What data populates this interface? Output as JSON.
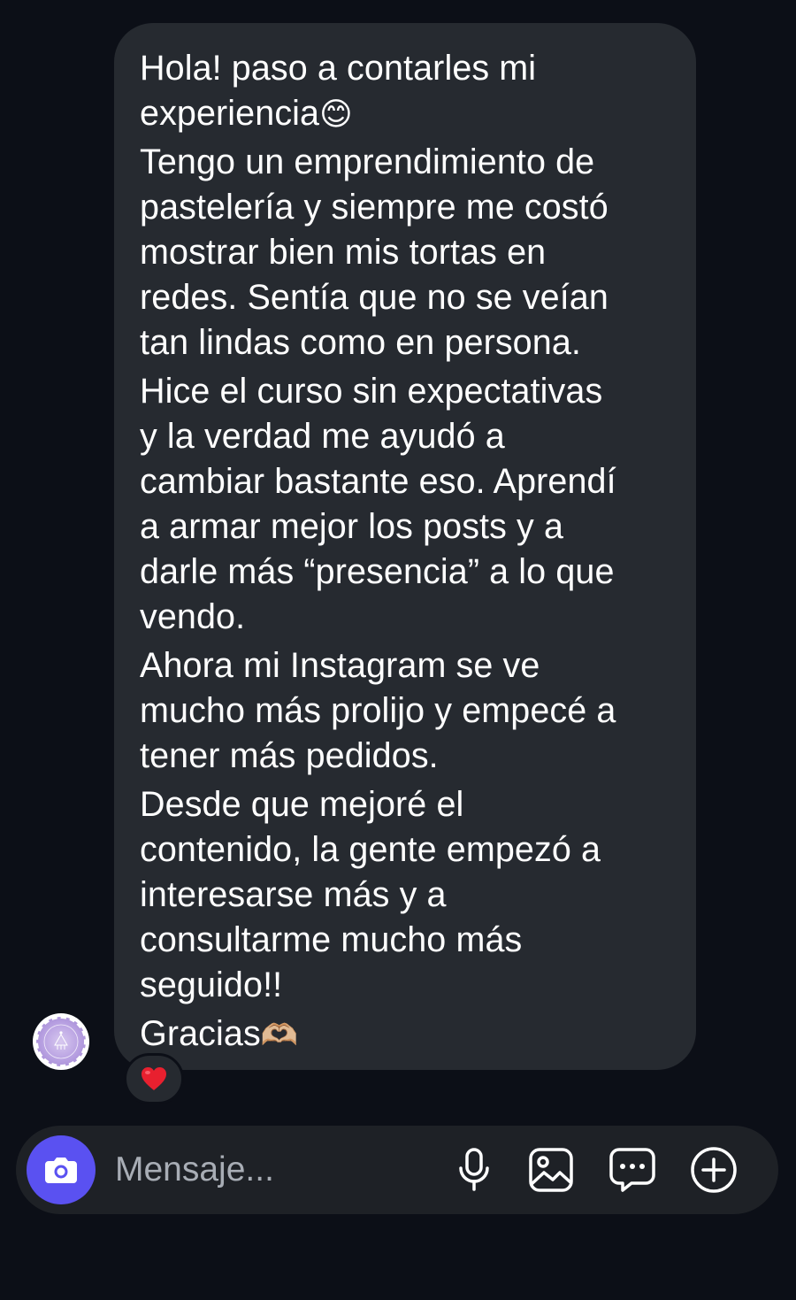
{
  "message": {
    "paragraphs": [
      "Hola! paso a contarles mi\nexperiencia",
      "Tengo un emprendimiento de\npastelería y siempre me costó\nmostrar bien mis tortas en\nredes. Sentía que no se veían\ntan lindas como en persona.",
      "Hice el curso sin expectativas\ny la verdad me ayudó a\ncambiar bastante eso. Aprendí\na armar mejor los posts y a\ndarle más “presencia” a lo que\nvendo.",
      "Ahora mi Instagram se ve\nmucho más prolijo y empecé a\ntener más pedidos.",
      "Desde que mejoré el\ncontenido, la gente empezó a\ninteresarse más y a\nconsultarme mucho más\nseguido!!",
      "Gracias"
    ],
    "emoji_after_paragraph_1": "😊",
    "emoji_after_paragraph_6": "🫶🏼",
    "reaction": "❤️"
  },
  "composer": {
    "placeholder": "Mensaje...",
    "camera_icon": "camera-icon",
    "mic_icon": "microphone-icon",
    "gallery_icon": "gallery-icon",
    "sticker_icon": "chat-bubble-icon",
    "plus_icon": "plus-circle-icon",
    "accent_color": "#5a51f1"
  },
  "colors": {
    "background": "#0c0f17",
    "bubble": "#262a30",
    "composer": "#1e2126",
    "placeholder": "#a8adb5"
  }
}
